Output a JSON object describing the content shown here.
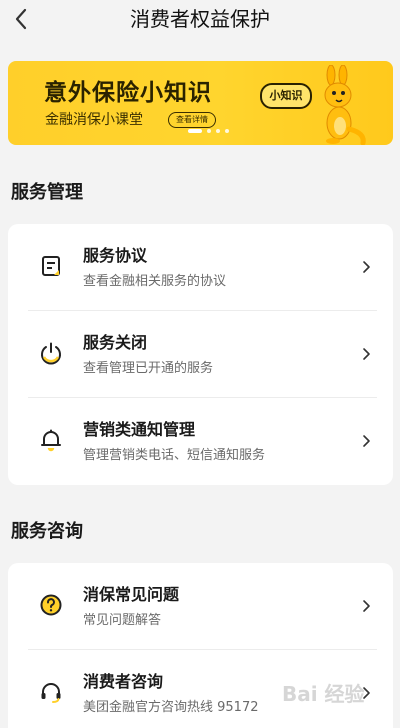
{
  "header": {
    "title": "消费者权益保护"
  },
  "banner": {
    "title": "意外保险小知识",
    "subtitle": "金融消保小课堂",
    "button_label": "查看详情",
    "bubble_text": "小知识",
    "slide_index": 1,
    "slide_count": 4,
    "accent_color": "#ffd02a"
  },
  "sections": {
    "management": {
      "title": "服务管理",
      "items": [
        {
          "title": "服务协议",
          "subtitle": "查看金融相关服务的协议",
          "icon": "document-icon"
        },
        {
          "title": "服务关闭",
          "subtitle": "查看管理已开通的服务",
          "icon": "power-icon"
        },
        {
          "title": "营销类通知管理",
          "subtitle": "管理营销类电话、短信通知服务",
          "icon": "bell-icon"
        }
      ]
    },
    "consult": {
      "title": "服务咨询",
      "items": [
        {
          "title": "消保常见问题",
          "subtitle": "常见问题解答",
          "icon": "question-icon"
        },
        {
          "title": "消费者咨询",
          "subtitle": "美团金融官方咨询热线 95172",
          "icon": "headset-icon"
        }
      ]
    }
  },
  "watermark": "Bai 经验"
}
